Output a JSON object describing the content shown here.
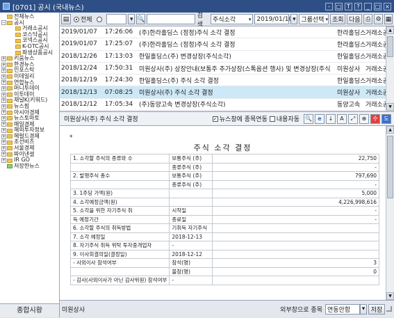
{
  "window": {
    "title": "[0701] 공시 (국내뉴스)",
    "icons": [
      "-",
      "□",
      "T",
      "?",
      "_",
      "□",
      "×"
    ]
  },
  "tree": {
    "items": [
      {
        "label": "전체뉴스",
        "exp": "",
        "level": 0,
        "color": "yellow"
      },
      {
        "label": "공시",
        "exp": "−",
        "level": 0,
        "color": "yellow"
      },
      {
        "label": "거래소공시",
        "exp": "",
        "level": 2,
        "color": "yellow"
      },
      {
        "label": "코스닥공시",
        "exp": "",
        "level": 2,
        "color": "yellow"
      },
      {
        "label": "코넥스공시",
        "exp": "",
        "level": 2,
        "color": "yellow"
      },
      {
        "label": "K-OTC공시",
        "exp": "",
        "level": 2,
        "color": "yellow"
      },
      {
        "label": "파생상품공시",
        "exp": "",
        "level": 2,
        "color": "yellow"
      },
      {
        "label": "키움뉴스",
        "exp": "+",
        "level": 0,
        "color": "yellow"
      },
      {
        "label": "한경뉴스",
        "exp": "+",
        "level": 0,
        "color": "yellow"
      },
      {
        "label": "인포스탁",
        "exp": "+",
        "level": 0,
        "color": "yellow"
      },
      {
        "label": "이데일리",
        "exp": "+",
        "level": 0,
        "color": "yellow"
      },
      {
        "label": "연합뉴스",
        "exp": "+",
        "level": 0,
        "color": "yellow"
      },
      {
        "label": "머니투데이",
        "exp": "+",
        "level": 0,
        "color": "yellow"
      },
      {
        "label": "이투데이",
        "exp": "+",
        "level": 0,
        "color": "yellow"
      },
      {
        "label": "채널K(키워드)",
        "exp": "+",
        "level": 0,
        "color": "yellow"
      },
      {
        "label": "뉴스핌",
        "exp": "+",
        "level": 0,
        "color": "yellow"
      },
      {
        "label": "아시아경제",
        "exp": "+",
        "level": 0,
        "color": "yellow"
      },
      {
        "label": "뉴스토마토",
        "exp": "+",
        "level": 0,
        "color": "yellow"
      },
      {
        "label": "매일경제",
        "exp": "+",
        "level": 0,
        "color": "yellow"
      },
      {
        "label": "해외투자정보",
        "exp": "+",
        "level": 0,
        "color": "yellow"
      },
      {
        "label": "헤럴드경제",
        "exp": "+",
        "level": 0,
        "color": "yellow"
      },
      {
        "label": "조선비즈",
        "exp": "+",
        "level": 0,
        "color": "yellow"
      },
      {
        "label": "서울경제",
        "exp": "+",
        "level": 0,
        "color": "yellow"
      },
      {
        "label": "파이낸셜",
        "exp": "+",
        "level": 0,
        "color": "yellow"
      },
      {
        "label": "IR GO",
        "exp": "+",
        "level": 0,
        "color": "yellow"
      },
      {
        "label": "저장한뉴스",
        "exp": "",
        "level": 0,
        "color": "green"
      }
    ]
  },
  "toolbar": {
    "radio_all": "전체",
    "search_label": "검색",
    "search_select": "주식소각",
    "date": "2019/01/10",
    "group_select": "그룹선택",
    "query_btn": "조회",
    "next_btn": "다음"
  },
  "news": {
    "rows": [
      {
        "date": "2019/01/07",
        "time": "17:26:06",
        "title": "(주)한라홀딩스 (정정)주식 소각 결정",
        "company": "한라홀딩스",
        "source": "거래소공"
      },
      {
        "date": "2019/01/07",
        "time": "17:25:07",
        "title": "(주)한라홀딩스 (정정)주식 소각 결정",
        "company": "한라홀딩스",
        "source": "거래소공"
      },
      {
        "date": "2018/12/26",
        "time": "17:13:03",
        "title": "한일홀딩스(주) 변경상장(주식소각)",
        "company": "한일홀딩스",
        "source": "거래소공"
      },
      {
        "date": "2018/12/24",
        "time": "17:50:31",
        "title": "미원상사(주) 상장안내(보통주 추가상장(스톡옵션 행사) 및 변경상장(주식",
        "company": "미원상사",
        "source": "거래소공"
      },
      {
        "date": "2018/12/19",
        "time": "17:24:30",
        "title": "한일홀딩스(주) 주식 소각 결정",
        "company": "한일홀딩스",
        "source": "거래소공"
      },
      {
        "date": "2018/12/13",
        "time": "07:08:25",
        "title": "미원상사(주) 주식 소각 결정",
        "company": "미원상사",
        "source": "거래소공"
      },
      {
        "date": "2018/12/12",
        "time": "17:05:34",
        "title": "(주)동양고속 변경상장(주식소각)",
        "company": "동양고속",
        "source": "거래소공"
      }
    ]
  },
  "doc_header": {
    "title": "미원상사(주) 주식 소각 결정",
    "link_label": "뉴스창에 종목연동",
    "content_label": "내용자동",
    "link_checked": true,
    "content_checked": false,
    "btn_red": "수",
    "btn_blue": "도"
  },
  "doc": {
    "star": "*",
    "title": "주식 소각 결정",
    "rows": [
      [
        "1. 소각할 주식의 종류와 수",
        "보통주식 (주)",
        "22,750"
      ],
      [
        "",
        "종류주식 (주)",
        "-"
      ],
      [
        "2. 발행주식 총수",
        "보통주식 (주)",
        "797,690"
      ],
      [
        "",
        "종류주식 (주)",
        "-"
      ],
      [
        "3. 1주당 가액(원)",
        "",
        "5,000"
      ],
      [
        "4. 소각예정금액(원)",
        "",
        "4,226,998,616"
      ],
      [
        "5. 소각을 위한 자기주식 취",
        "시작일",
        "-"
      ],
      [
        "득 예정기간",
        "종료일",
        "-"
      ],
      [
        "6. 소각할 주식의 취득방법",
        "기취득 자기주식",
        ""
      ],
      [
        "7. 소각 예정일",
        "2018-12-13",
        ""
      ],
      [
        "8. 자기주식 취득 위탁 투자중개업자",
        "-",
        ""
      ],
      [
        "9. 이사회결의일(결정일)",
        "2018-12-12",
        ""
      ],
      [
        "- 사외이사 참석여부",
        "참석(명)",
        "3"
      ],
      [
        "",
        "불참(명)",
        "0"
      ],
      [
        "- 감사(사외이사가 아닌 감사위원) 참석여부",
        "-",
        ""
      ]
    ]
  },
  "bottom": {
    "left_label": "종합시황",
    "company": "미원상사",
    "ext_label": "외부창으로 종목",
    "select": "연동안함",
    "save_btn": "저장"
  }
}
